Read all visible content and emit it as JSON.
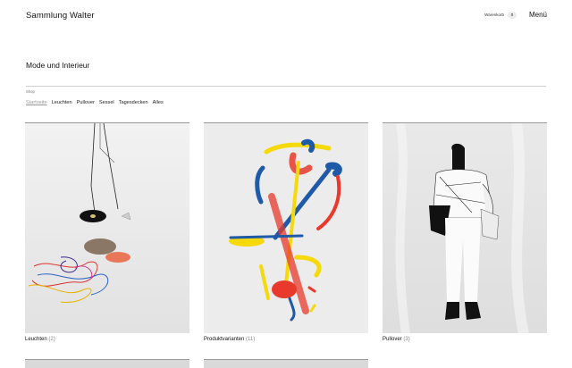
{
  "header": {
    "site_title": "Sammlung Walter",
    "cart_label": "Warenkorb",
    "cart_count": "0",
    "menu_label": "Menü"
  },
  "section": {
    "title": "Mode und Interieur",
    "shop_label": "Shop"
  },
  "filters": [
    {
      "label": "Startseite",
      "active": true
    },
    {
      "label": "Leuchten"
    },
    {
      "label": "Pullover"
    },
    {
      "label": "Sessel"
    },
    {
      "label": "Tagesdecken"
    },
    {
      "label": "Alles"
    }
  ],
  "products": [
    {
      "title": "Leuchten",
      "count": "(2)"
    },
    {
      "title": "Produktvarianten",
      "count": "(11)"
    },
    {
      "title": "Pullover",
      "count": "(3)"
    }
  ],
  "colors": {
    "accent_blue": "#1f5aa8",
    "accent_yellow": "#f5d90a",
    "accent_red": "#e8392c",
    "divider": "#cfcfcf"
  }
}
